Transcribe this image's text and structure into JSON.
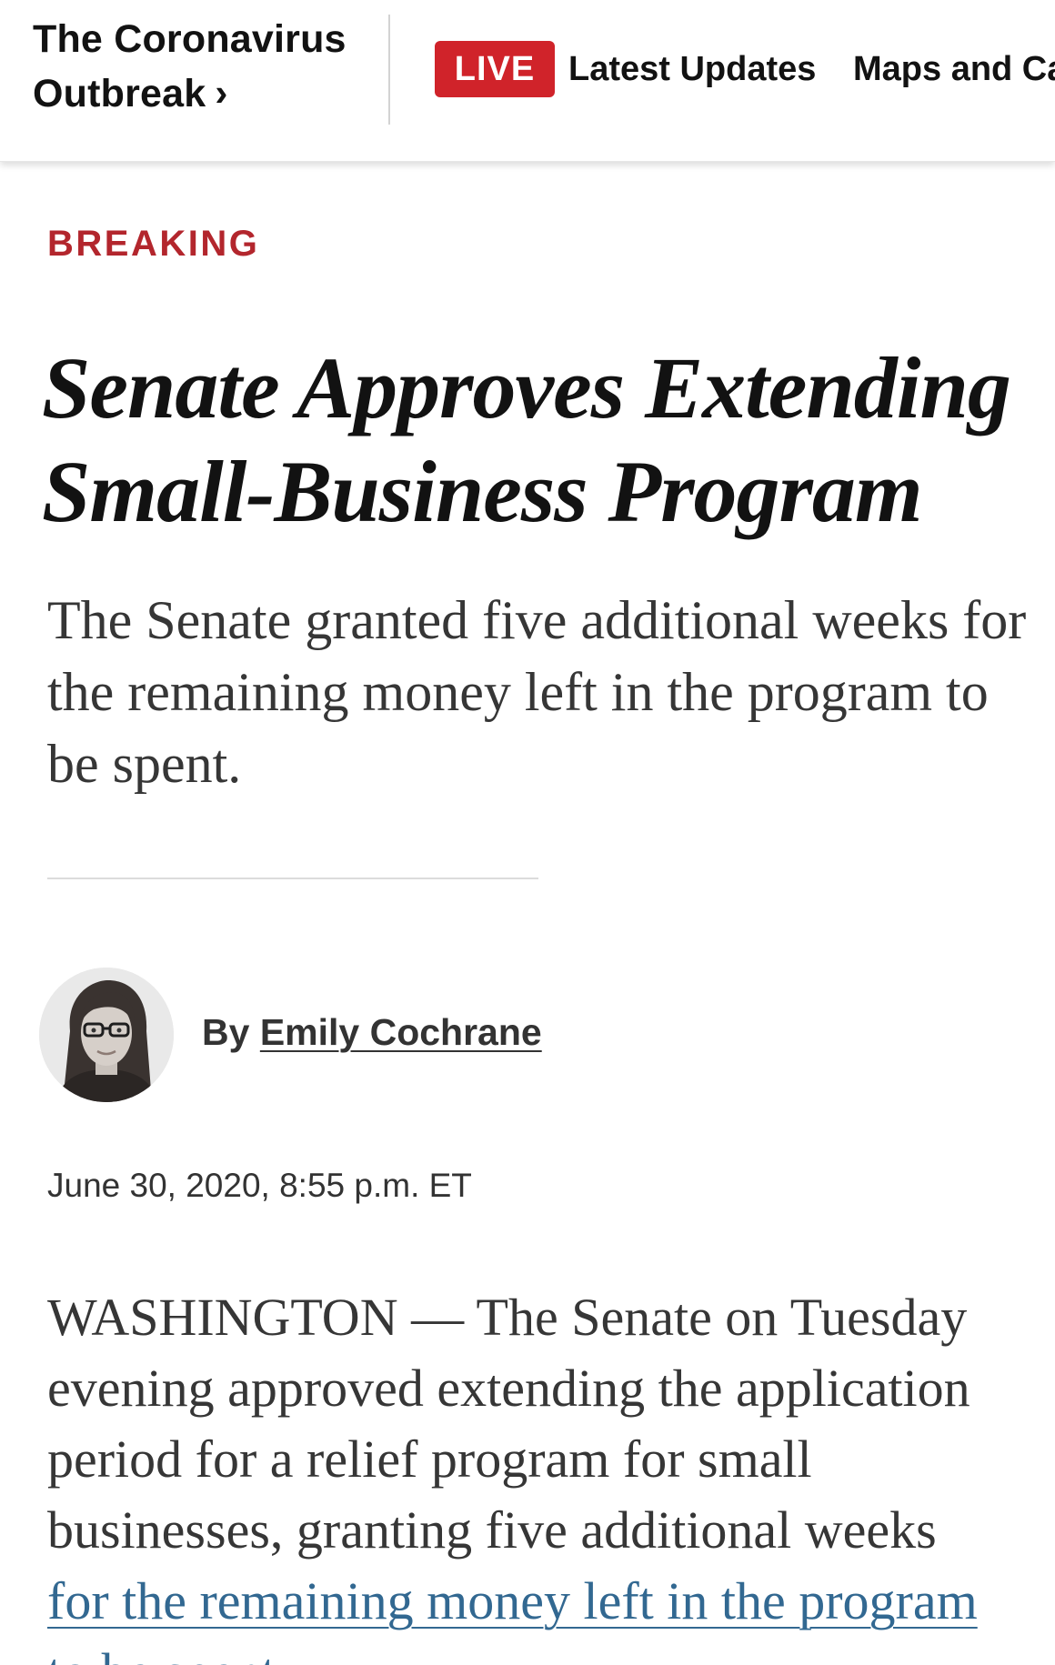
{
  "nav": {
    "section_line1": "The Coronavirus",
    "section_line2": "Outbreak",
    "chevron": "›",
    "live_badge": "LIVE",
    "latest_updates": "Latest Updates",
    "maps_and_cases": "Maps and Cas"
  },
  "article": {
    "kicker": "BREAKING",
    "headline": [
      "Senate Approves Extending",
      "Small-Business Program"
    ],
    "summary": [
      "The Senate granted five additional weeks for",
      "the remaining money left in the program to",
      "be spent."
    ],
    "byline_prefix": "By",
    "author": "Emily Cochrane",
    "timestamp": "June 30, 2020, 8:55 p.m. ET",
    "body": [
      "WASHINGTON — The Senate on Tuesday",
      "evening approved extending the application",
      "period for a relief program for small",
      "businesses, granting five additional weeks"
    ],
    "body_link": [
      "for the remaining money left in the program",
      "to be spent"
    ]
  },
  "colors": {
    "live_badge": "#d0232a",
    "kicker": "#b3262d",
    "link": "#326891"
  }
}
